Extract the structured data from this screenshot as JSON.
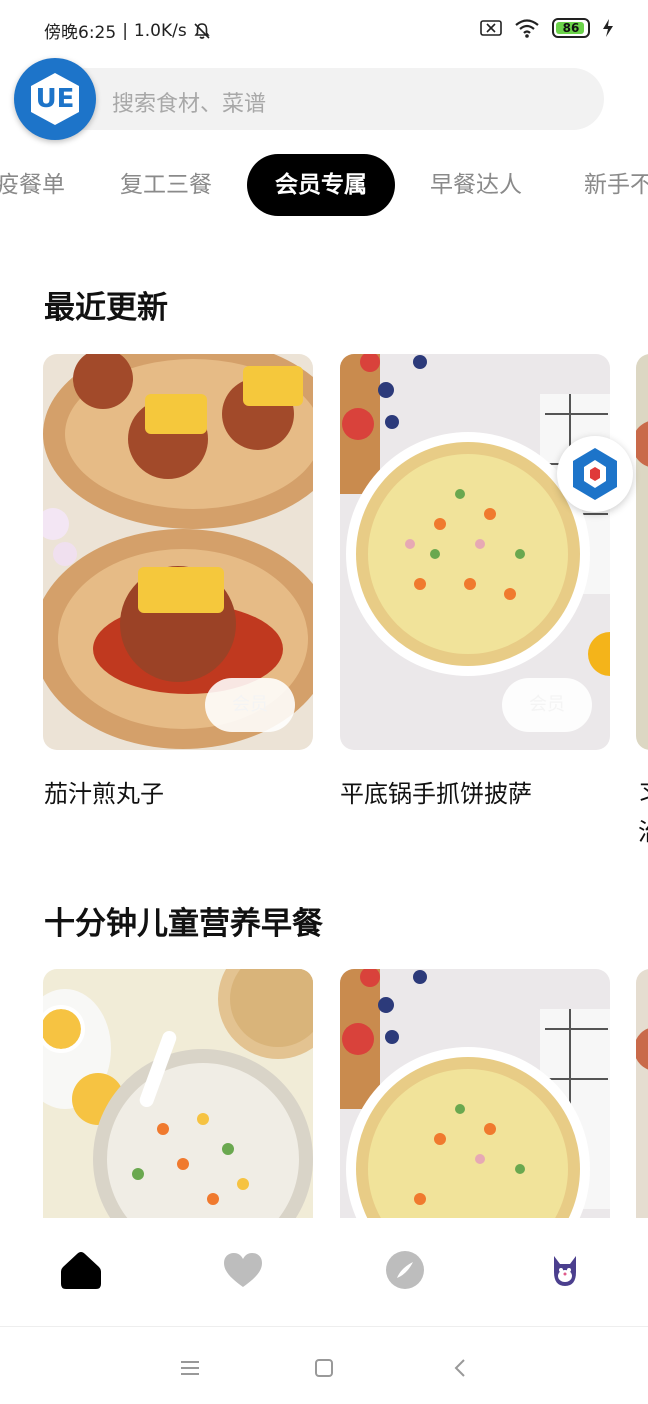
{
  "status_bar": {
    "time": "傍晚6:25",
    "network_speed": "1.0K/s",
    "separator": "|",
    "battery": "86"
  },
  "search": {
    "placeholder": "搜索食材、菜谱"
  },
  "logo": {
    "text": "UE"
  },
  "tabs": [
    {
      "label": "疫餐单"
    },
    {
      "label": "复工三餐"
    },
    {
      "label": "会员专属",
      "active": true
    },
    {
      "label": "早餐达人"
    },
    {
      "label": "新手不"
    }
  ],
  "sections": [
    {
      "title": "最近更新",
      "cards": [
        {
          "title": "茄汁煎丸子",
          "badge": "会员"
        },
        {
          "title": "平底锅手抓饼披萨",
          "badge": "会员"
        },
        {
          "title_line1": "习",
          "title_line2": "治"
        }
      ]
    },
    {
      "title": "十分钟儿童营养早餐",
      "cards": [
        {
          "title": ""
        },
        {
          "title": ""
        }
      ]
    }
  ],
  "colors": {
    "accent_active_tab": "#000000",
    "battery_green": "#6bd34a",
    "logo_blue": "#1d74c9",
    "placeholder": "#a8a8a8"
  },
  "icons": {
    "nav": [
      "home-icon",
      "heart-icon",
      "compass-icon",
      "cat-avatar-icon"
    ],
    "system": [
      "menu-icon",
      "square-icon",
      "back-icon"
    ]
  }
}
